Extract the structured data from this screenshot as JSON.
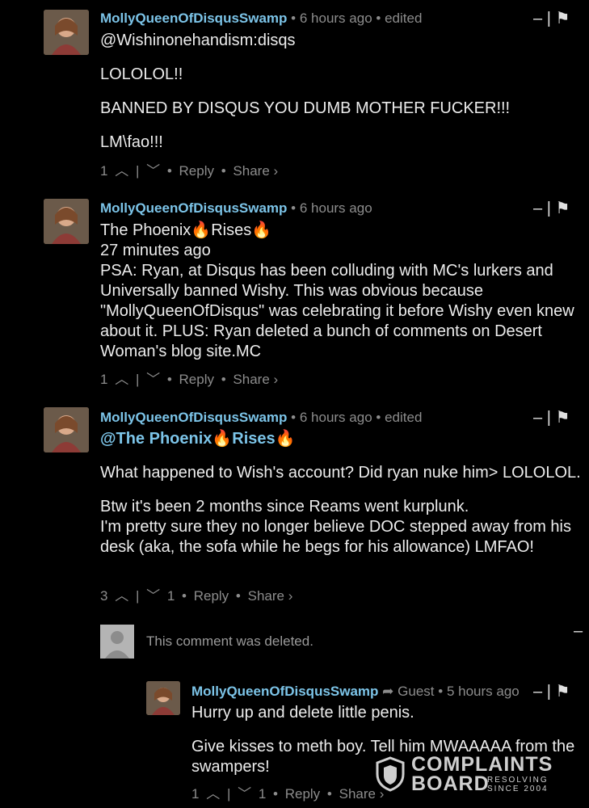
{
  "comments": [
    {
      "author": "MollyQueenOfDisqusSwamp",
      "time": "6 hours ago",
      "edited": "edited",
      "lines": [
        "@Wishinonehandism:disqs",
        "LOLOLOL!!",
        "BANNED BY DISQUS YOU DUMB MOTHER FUCKER!!!",
        "LM\\fao!!!"
      ],
      "upvotes": "1",
      "downvotes": "",
      "reply": "Reply",
      "share": "Share ›"
    },
    {
      "author": "MollyQueenOfDisqusSwamp",
      "time": "6 hours ago",
      "lines": [
        "The Phoenix🔥Rises🔥",
        "27 minutes ago",
        "PSA: Ryan, at Disqus has been colluding with MC's lurkers and Universally banned Wishy. This was obvious because \"MollyQueenOfDisqus\" was celebrating it before Wishy even knew about it. PLUS: Ryan deleted a bunch of comments on Desert Woman's blog site.MC"
      ],
      "upvotes": "1",
      "downvotes": "",
      "reply": "Reply",
      "share": "Share ›"
    },
    {
      "author": "MollyQueenOfDisqusSwamp",
      "time": "6 hours ago",
      "edited": "edited",
      "mention": "@The Phoenix🔥Rises🔥",
      "lines": [
        "What happened to Wish's account? Did ryan nuke him> LOLOLOL.",
        "Btw it's been 2 months since Reams went kurplunk.",
        "I'm pretty sure they no longer believe DOC stepped away from his desk (aka, the sofa while he begs for his allowance) LMFAO!"
      ],
      "upvotes": "3",
      "downvotes": "1",
      "reply": "Reply",
      "share": "Share ›"
    },
    {
      "deleted_text": "This comment was deleted."
    },
    {
      "author": "MollyQueenOfDisqusSwamp",
      "reply_to": "Guest",
      "time": "5 hours ago",
      "lines": [
        "Hurry up and delete little penis.",
        "Give kisses to meth boy. Tell him MWAAAAA from the swampers!"
      ],
      "upvotes": "1",
      "downvotes": "1",
      "reply": "Reply",
      "share": "Share ›"
    }
  ],
  "watermark": {
    "line1": "COMPLAINTS",
    "line2": "BOARD",
    "tag1": "RESOLVING",
    "tag2": "SINCE 2004"
  },
  "icons": {
    "upvote": "chevron-up-icon",
    "downvote": "chevron-down-icon",
    "flag": "flag-icon",
    "collapse": "collapse-icon"
  }
}
